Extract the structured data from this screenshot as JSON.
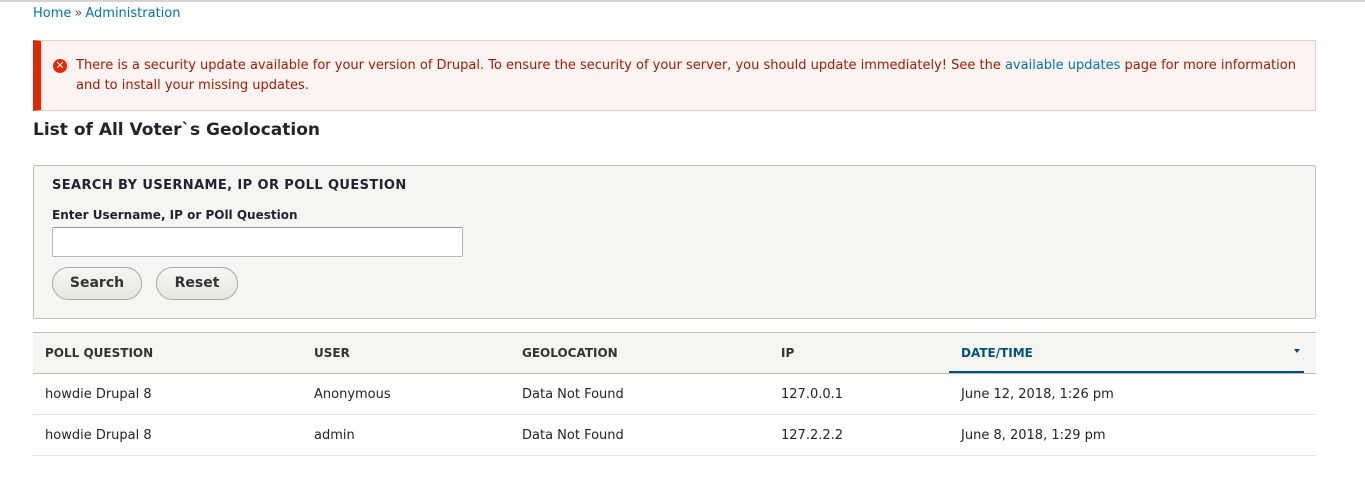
{
  "breadcrumb": {
    "home": "Home",
    "separator": "»",
    "admin": "Administration"
  },
  "alert": {
    "icon": "error-icon",
    "text_before": "There is a security update available for your version of Drupal. To ensure the security of your server, you should update immediately! See the ",
    "link": "available updates",
    "text_after": " page for more information and to install your missing updates.",
    "colors": {
      "border": "#e62600",
      "text": "#a51b00",
      "background": "#fcf4f2"
    }
  },
  "page": {
    "title": "List of All Voter`s Geolocation"
  },
  "search": {
    "legend": "SEARCH BY USERNAME, IP OR POLL QUESTION",
    "label": "Enter Username, IP or POll Question",
    "value": "",
    "placeholder": "",
    "search_button": "Search",
    "reset_button": "Reset"
  },
  "table": {
    "headers": [
      "POLL QUESTION",
      "USER",
      "GEOLOCATION",
      "IP",
      "DATE/TIME"
    ],
    "sorted_column": "DATE/TIME",
    "rows": [
      [
        "howdie Drupal 8",
        "Anonymous",
        "Data Not Found",
        "127.0.0.1",
        "June 12, 2018, 1:26 pm"
      ],
      [
        "howdie Drupal 8",
        "admin",
        "Data Not Found",
        "127.2.2.2",
        "June 8, 2018, 1:29 pm"
      ]
    ]
  }
}
